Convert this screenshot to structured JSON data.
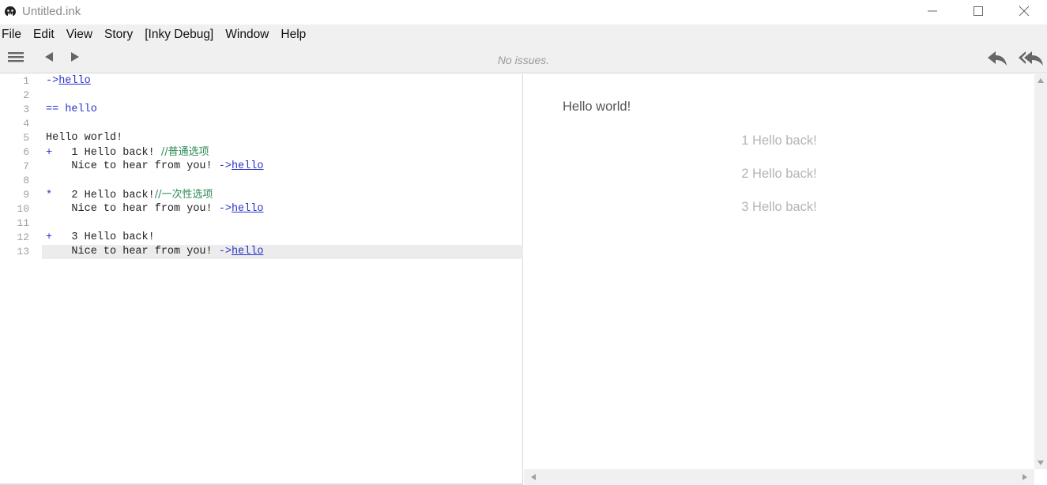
{
  "window": {
    "title": "Untitled.ink"
  },
  "menu": {
    "items": [
      "File",
      "Edit",
      "View",
      "Story",
      "[Inky Debug]",
      "Window",
      "Help"
    ]
  },
  "toolbar": {
    "status": "No issues.",
    "icons": [
      "hamburger-menu-icon",
      "back-arrow-icon",
      "forward-arrow-icon",
      "rewind-one-icon",
      "restart-story-icon"
    ]
  },
  "editor": {
    "active_line": 13,
    "lines": [
      {
        "n": "1"
      },
      {
        "n": "2"
      },
      {
        "n": "3"
      },
      {
        "n": "4"
      },
      {
        "n": "5"
      },
      {
        "n": "6"
      },
      {
        "n": "7"
      },
      {
        "n": "8"
      },
      {
        "n": "9"
      },
      {
        "n": "10"
      },
      {
        "n": "11"
      },
      {
        "n": "12"
      },
      {
        "n": "13"
      }
    ],
    "code": {
      "l1_arrow": "->",
      "l1_target": "hello",
      "l3_knot": "== hello",
      "l5_text": "Hello world!",
      "l6_bullet": "+",
      "l6_text": "   1 Hello back! ",
      "l6_comment": "//普通选项",
      "l7_text": "    Nice to hear from you! ",
      "l7_arrow": "->",
      "l7_target": "hello",
      "l9_bullet": "*",
      "l9_text": "   2 Hello back!",
      "l9_comment": "//一次性选项",
      "l10_text": "    Nice to hear from you! ",
      "l10_arrow": "->",
      "l10_target": "hello",
      "l12_bullet": "+",
      "l12_text": "   3 Hello back!",
      "l13_text": "    Nice to hear from you! ",
      "l13_arrow": "->",
      "l13_target": "hello"
    }
  },
  "player": {
    "story_text": "Hello world!",
    "choices": [
      "1 Hello back!",
      "2 Hello back!",
      "3 Hello back!"
    ]
  },
  "colors": {
    "keyword_blue": "#2a33c9",
    "comment_green": "#2e8b57",
    "choice_gray": "#b4b4b4"
  }
}
